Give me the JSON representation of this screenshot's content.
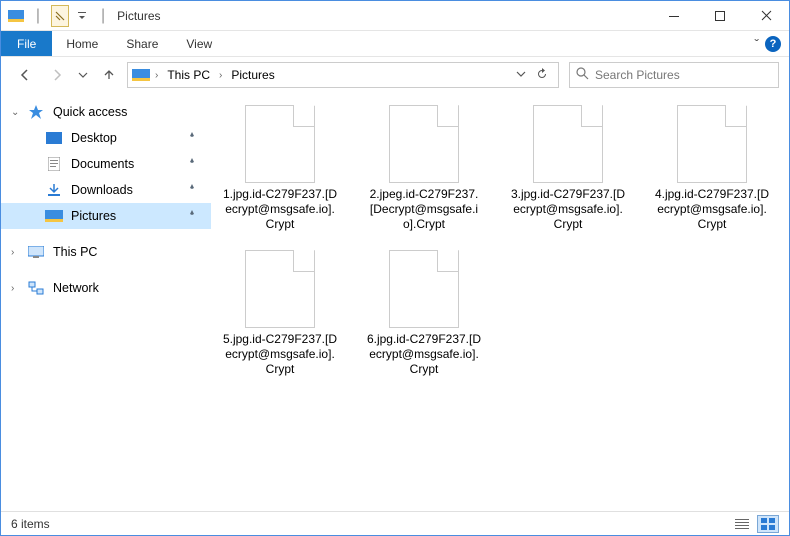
{
  "titlebar": {
    "separator": "|",
    "title": "Pictures"
  },
  "win_controls": {
    "minimize": "–",
    "maximize": "☐",
    "close": "✕"
  },
  "ribbon": {
    "file": "File",
    "tabs": [
      "Home",
      "Share",
      "View"
    ],
    "down_caret": "ˇ",
    "help": "?"
  },
  "nav": {
    "back": "←",
    "forward": "→",
    "recent_caret": "ˇ",
    "up": "↑"
  },
  "breadcrumb": {
    "sep": "›",
    "items": [
      "This PC",
      "Pictures"
    ],
    "history_caret": "ˇ",
    "refresh": "⟳"
  },
  "search": {
    "icon": "🔍",
    "placeholder": "Search Pictures"
  },
  "sidebar": {
    "quick_access": "Quick access",
    "pinned": [
      {
        "icon": "desktop",
        "label": "Desktop"
      },
      {
        "icon": "document",
        "label": "Documents"
      },
      {
        "icon": "download",
        "label": "Downloads"
      },
      {
        "icon": "pictures",
        "label": "Pictures"
      }
    ],
    "this_pc": "This PC",
    "network": "Network",
    "pin_glyph": "📌",
    "expand_glyph": "›",
    "collapse_glyph": "⌄"
  },
  "files": [
    {
      "name": "1.jpg.id-C279F237.[Decrypt@msgsafe.io].Crypt"
    },
    {
      "name": "2.jpeg.id-C279F237.[Decrypt@msgsafe.io].Crypt"
    },
    {
      "name": "3.jpg.id-C279F237.[Decrypt@msgsafe.io].Crypt"
    },
    {
      "name": "4.jpg.id-C279F237.[Decrypt@msgsafe.io].Crypt"
    },
    {
      "name": "5.jpg.id-C279F237.[Decrypt@msgsafe.io].Crypt"
    },
    {
      "name": "6.jpg.id-C279F237.[Decrypt@msgsafe.io].Crypt"
    }
  ],
  "status": {
    "count": "6 items"
  },
  "colors": {
    "accent": "#1979ca",
    "selection": "#cce8ff"
  }
}
